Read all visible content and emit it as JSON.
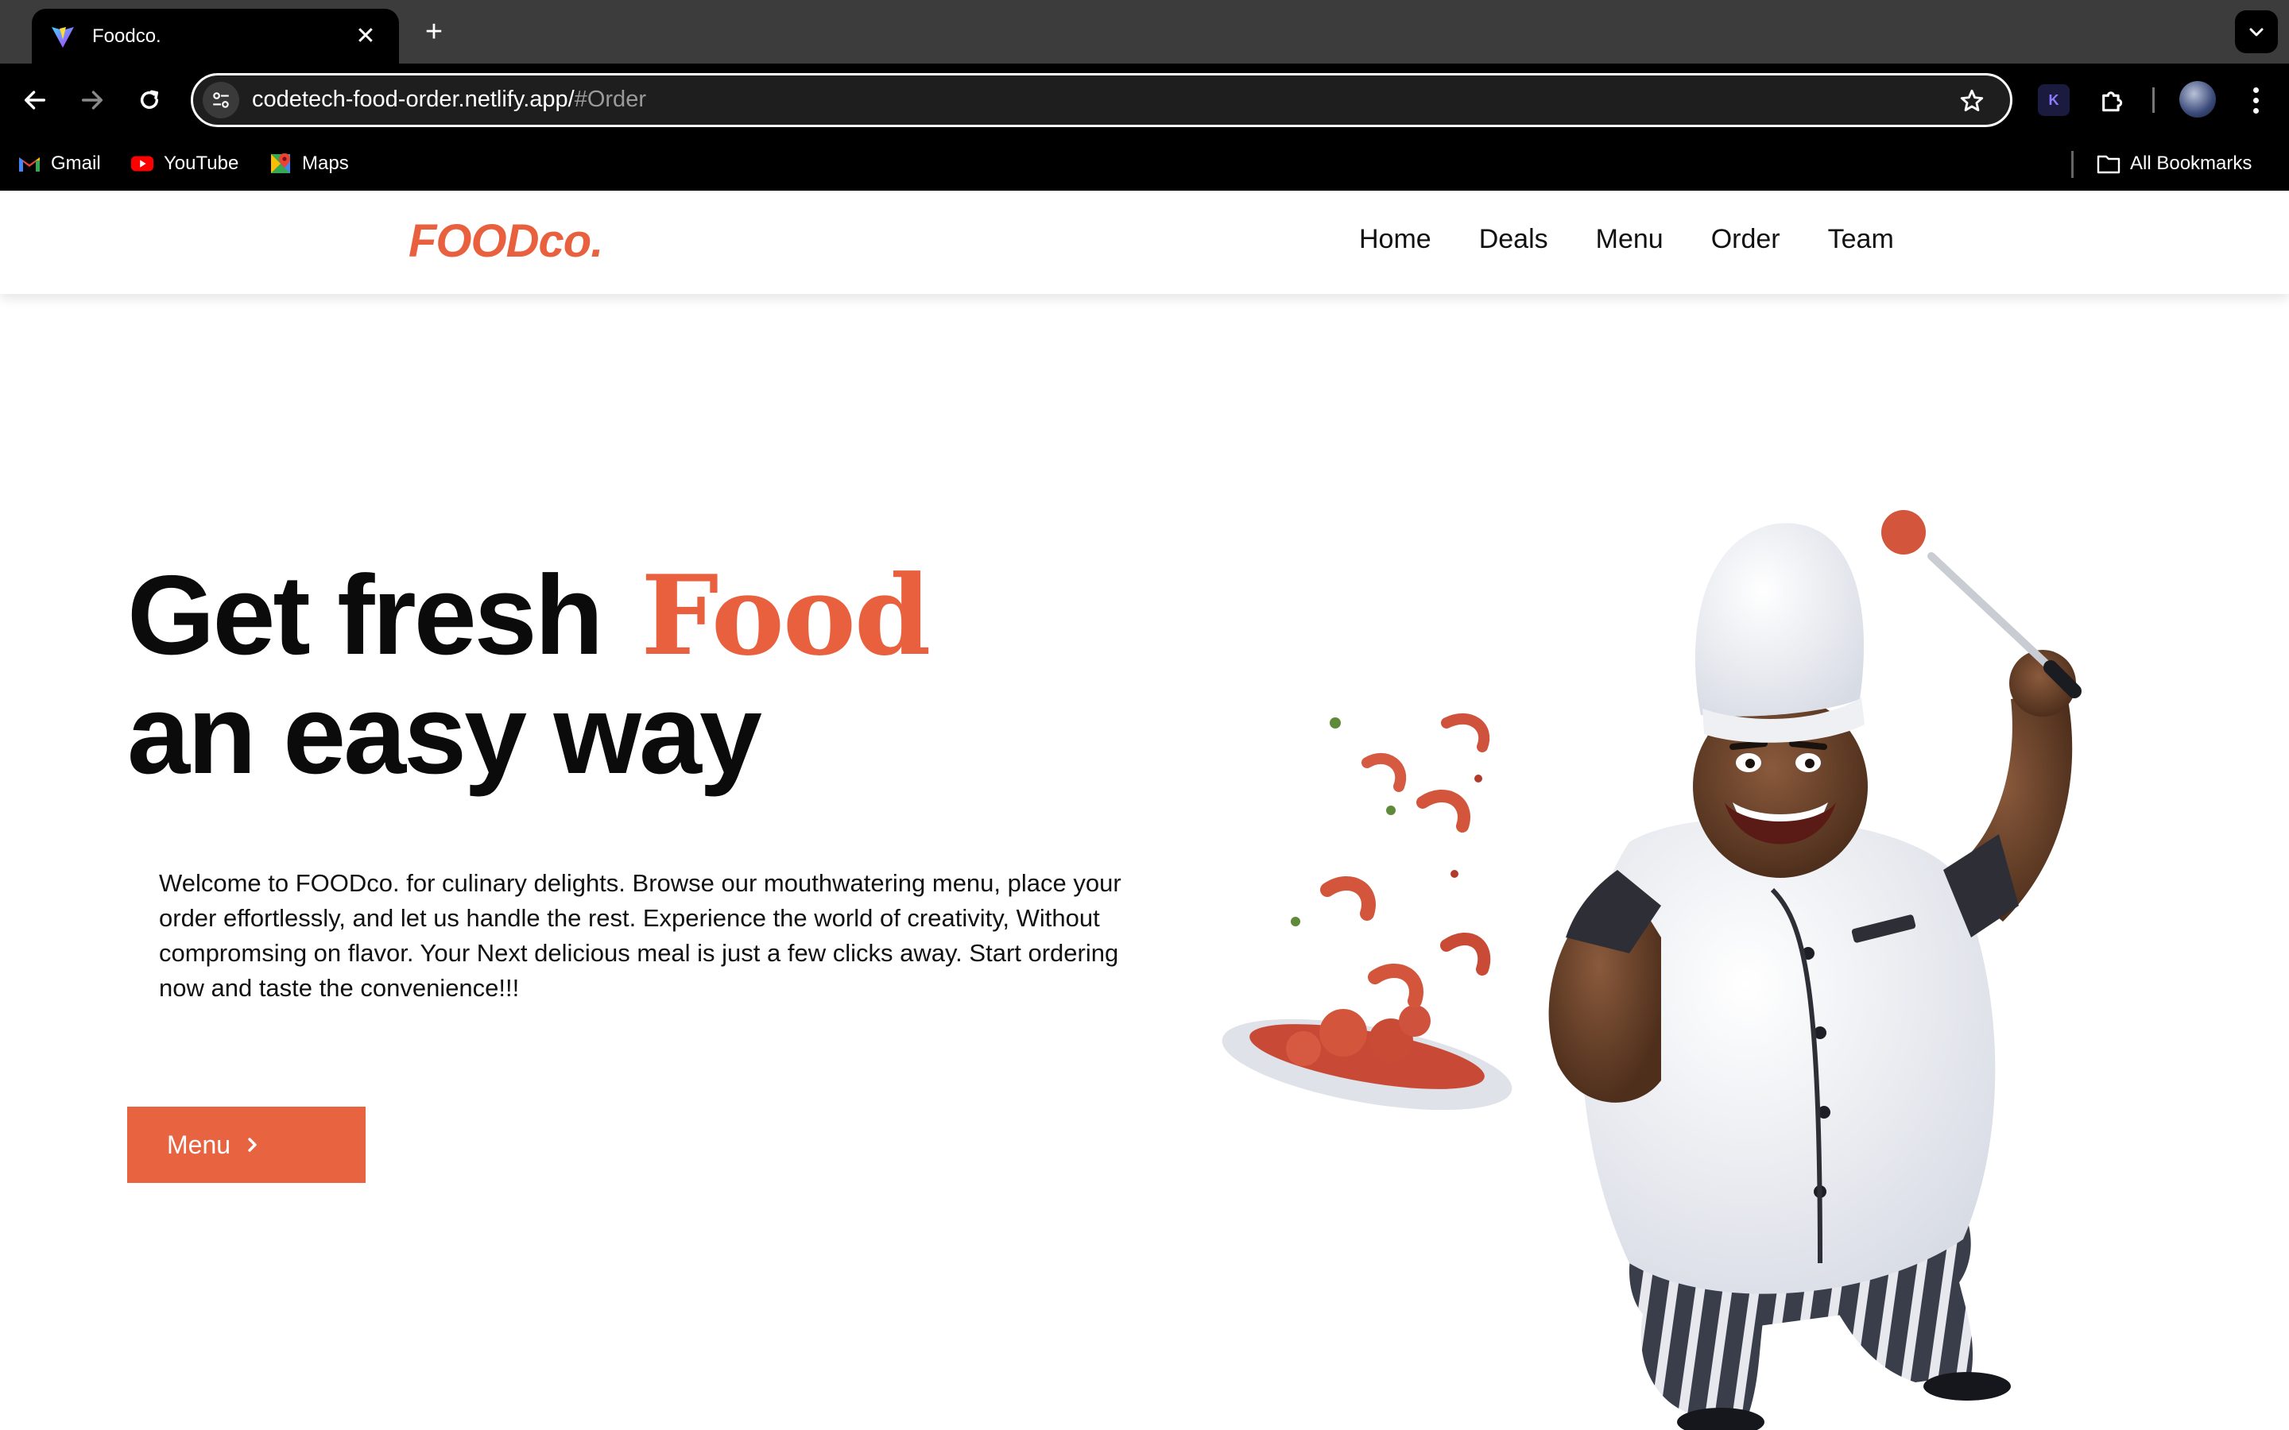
{
  "browser": {
    "tab_title": "Foodco.",
    "url_host": "codetech-food-order.netlify.app/",
    "url_fragment": "#Order",
    "bookmarks": [
      {
        "label": "Gmail",
        "icon": "gmail-icon"
      },
      {
        "label": "YouTube",
        "icon": "youtube-icon"
      },
      {
        "label": "Maps",
        "icon": "maps-icon"
      }
    ],
    "all_bookmarks": "All Bookmarks"
  },
  "site": {
    "logo": "FOODco.",
    "nav": [
      "Home",
      "Deals",
      "Menu",
      "Order",
      "Team"
    ],
    "accent_color": "#e8603d"
  },
  "hero": {
    "title_line1": "Get fresh",
    "title_highlight": "Food",
    "title_line2": "an easy way",
    "description": "Welcome to FOODco. for culinary delights. Browse our mouthwatering menu, place your order effortlessly, and let us handle the rest. Experience the world of creativity, Without compromsing on flavor. Your Next delicious meal is just a few clicks away. Start ordering now and taste the convenience!!!",
    "button_label": "Menu"
  }
}
